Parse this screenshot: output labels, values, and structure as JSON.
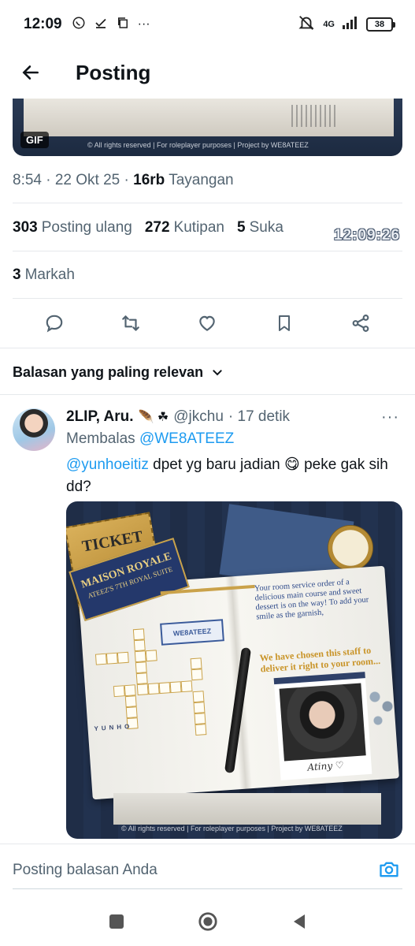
{
  "status_bar": {
    "time": "12:09",
    "network": "4G",
    "battery": "38"
  },
  "header": {
    "title": "Posting"
  },
  "top_media": {
    "badge": "GIF",
    "credit": "© All rights reserved | For roleplayer purposes | Project by WE8ATEEZ"
  },
  "post_meta": {
    "time_date": "8:54 · 22 Okt 25 · ",
    "views_count": "16rb",
    "views_label": "Tayangan"
  },
  "stats": {
    "reposts_count": "303",
    "reposts_label": "Posting ulang",
    "quotes_count": "272",
    "quotes_label": "Kutipan",
    "likes_count": "5",
    "likes_label": "Suka",
    "bookmarks_count": "3",
    "bookmarks_label": "Markah"
  },
  "overlay_time": "12:09:26",
  "actions": [
    "reply-icon",
    "repost-icon",
    "like-icon",
    "bookmark-icon",
    "share-icon"
  ],
  "sort": {
    "label": "Balasan yang paling relevan"
  },
  "reply": {
    "name": "2LIP, Aru.",
    "name_emoji": "🪶 ☘",
    "handle": "@jkchu",
    "time": "· 17 detik",
    "replying_prefix": "Membalas",
    "replying_to": "@WE8ATEEZ",
    "mention": "@yunhoeitiz",
    "text": " dpet yg baru jadian 😋 peke gak sih dd?",
    "image": {
      "ticket": "TICKET",
      "tag_title": "MAISON ROYALE",
      "tag_subtitle": "ATEEZ'S 7TH ROYAL SUITE",
      "stamp": "WE8ATEEZ",
      "grid_word": "YUNHO",
      "page_text": "Your room service order of a delicious main course and sweet dessert is on the way! To add your smile as the garnish,",
      "page_highlight": "We have chosen this staff to deliver it right to your room...",
      "signature": "Atiny ♡",
      "credit": "© All rights reserved | For roleplayer purposes | Project by WE8ATEEZ"
    }
  },
  "compose": {
    "placeholder": "Posting balasan Anda"
  },
  "colors": {
    "accent": "#1d9bf0",
    "text": "#0f1419",
    "secondary": "#536471",
    "divider": "#e6e9ec"
  }
}
